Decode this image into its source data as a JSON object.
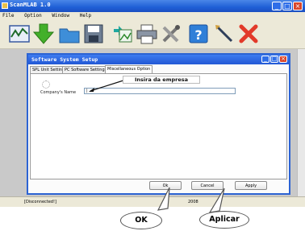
{
  "app": {
    "title": "ScanMLAB 1.0",
    "menu": [
      "File",
      "Option",
      "Window",
      "Help"
    ]
  },
  "dialog": {
    "title": "Software System Setup",
    "tabs": [
      "SPL Unit Setting",
      "PC Software Setting",
      "Miscellaneous Option"
    ],
    "active_tab": "Miscellaneous Option",
    "field_label": "Company's Name",
    "field_value": "|",
    "ok_label": "Ok",
    "cancel_label": "Cancel",
    "apply_label": "Apply"
  },
  "statusbar": {
    "left": "[Disconnected!]",
    "right": "2008"
  },
  "annotations": {
    "callout": "Insira da empresa",
    "ok_bubble": "OK",
    "apply_bubble": "Aplicar"
  },
  "colors": {
    "titlebar": "#1f5fd6",
    "close_button": "#d9472b",
    "toolbar_bg": "#ece9d8"
  }
}
